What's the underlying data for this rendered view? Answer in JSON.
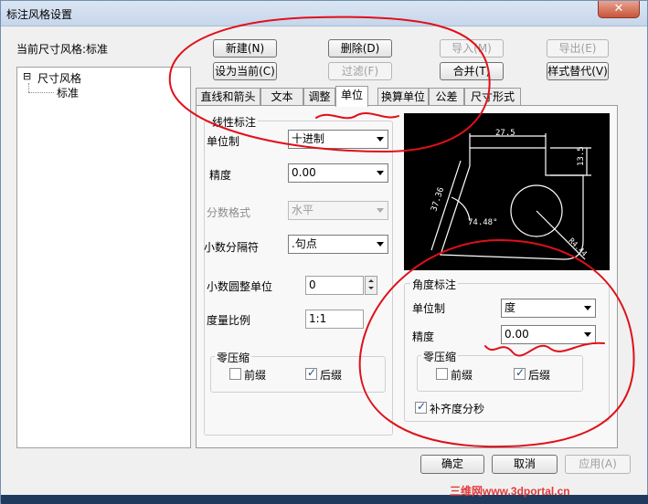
{
  "window": {
    "title": "标注风格设置",
    "close_glyph": "✕"
  },
  "current_style": {
    "label": "当前尺寸风格:标准"
  },
  "tree": {
    "toggle": "⊟",
    "root": "尺寸风格",
    "child": "标准"
  },
  "toolbar": {
    "new": "新建(N)",
    "delete": "删除(D)",
    "import": "导入(M)",
    "export": "导出(E)",
    "set_current": "设为当前(C)",
    "filter": "过滤(F)",
    "merge": "合并(T)",
    "replace": "样式替代(V)"
  },
  "tabs": [
    "直线和箭头",
    "文本",
    "调整",
    "单位",
    "换算单位",
    "公差",
    "尺寸形式"
  ],
  "linear": {
    "title": "线性标注",
    "unit_label": "单位制",
    "unit_value": "十进制",
    "precision_label": "精度",
    "precision_value": "0.00",
    "fraction_label": "分数格式",
    "fraction_value": "水平",
    "decimal_sep_label": "小数分隔符",
    "decimal_sep_value": ".句点",
    "round_label": "小数圆整单位",
    "round_value": "0",
    "scale_label": "度量比例",
    "scale_value": "1:1",
    "zero_title": "零压缩",
    "leading_label": "前缀",
    "trailing_label": "后缀",
    "leading_checked": false,
    "trailing_checked": true
  },
  "angular": {
    "title": "角度标注",
    "unit_label": "单位制",
    "unit_value": "度",
    "precision_label": "精度",
    "precision_value": "0.00",
    "zero_title": "零压缩",
    "leading_label": "前缀",
    "trailing_label": "后缀",
    "leading_checked": false,
    "trailing_checked": true,
    "pad_label": "补齐度分秒",
    "pad_checked": true
  },
  "preview": {
    "dim_top": "27.5",
    "dim_right": "13.5",
    "dim_left": "37.36",
    "dim_angle": "74.48°",
    "dim_radius": "R4.44"
  },
  "buttons": {
    "ok": "确定",
    "cancel": "取消",
    "apply": "应用(A)"
  },
  "watermark": "三维网www.3dportal.cn",
  "colors": {
    "annotation": "#e0101a",
    "preview_bg": "#000000",
    "preview_line": "#ffffff"
  }
}
